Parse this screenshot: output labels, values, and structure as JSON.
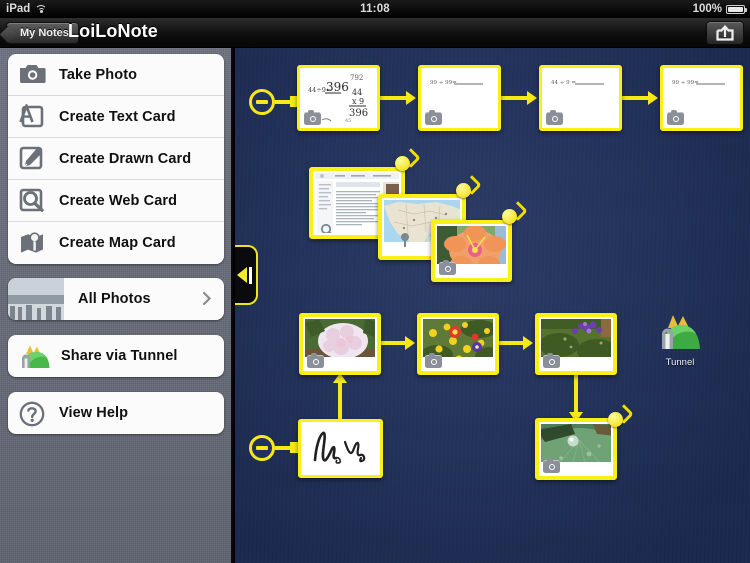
{
  "status_bar": {
    "device": "iPad",
    "wifi_icon": "wifi-icon",
    "time": "11:08",
    "battery_percent": "100%",
    "battery_icon": "battery-full-icon"
  },
  "navbar": {
    "back_button": "My Notes",
    "title": "LoiLoNote",
    "share_button_icon": "share-export-icon"
  },
  "sidebar": {
    "create_group": [
      {
        "label": "Take Photo",
        "icon": "camera-icon"
      },
      {
        "label": "Create Text Card",
        "icon": "text-card-icon"
      },
      {
        "label": "Create Drawn Card",
        "icon": "pencil-draw-icon"
      },
      {
        "label": "Create Web Card",
        "icon": "magnifier-web-icon"
      },
      {
        "label": "Create Map Card",
        "icon": "map-pin-icon"
      }
    ],
    "photos_row": {
      "label": "All Photos",
      "icon": "photo-thumbnail",
      "chevron": "chevron-right-icon"
    },
    "share_row": {
      "label": "Share via Tunnel",
      "icon": "tunnel-icon"
    },
    "help_row": {
      "label": "View Help",
      "icon": "question-mark-icon"
    }
  },
  "canvas": {
    "background_color": "#20325f",
    "accent_color": "#f7e817",
    "drawer_toggle": {
      "name": "collapse-sidebar-tab",
      "icon": "triangle-left-icon"
    },
    "tunnel_shortcut": {
      "label": "Tunnel",
      "icon": "tunnel-icon"
    },
    "rows": [
      {
        "name": "top-row-note-chain",
        "start_node": "minus-collapse-node",
        "cards": [
          {
            "type": "text-note",
            "content": "44÷9=396   792  44  x 9  396",
            "badge": "camera-badge"
          },
          {
            "type": "text-note",
            "content": "99 ÷ 99 = ______",
            "badge": "camera-badge"
          },
          {
            "type": "text-note",
            "content": "44 ÷ 9 = ______",
            "badge": "camera-badge"
          },
          {
            "type": "text-note",
            "content": "99 ÷ 99 = ______",
            "badge": "camera-badge"
          }
        ]
      },
      {
        "name": "media-stack",
        "cards": [
          {
            "type": "web-card",
            "content": "web page screenshot",
            "handle": "rotate-handle"
          },
          {
            "type": "map-card",
            "content": "north america map with pin",
            "handle": "rotate-handle"
          },
          {
            "type": "photo-card",
            "content": "orange hibiscus flower",
            "handle": "rotate-handle",
            "badge": "camera-badge"
          }
        ]
      },
      {
        "name": "bottom-photo-chain",
        "cards": [
          {
            "type": "photo-card",
            "content": "pink hydrangea blossom",
            "badge": "camera-badge"
          },
          {
            "type": "photo-card",
            "content": "yellow and red wildflowers",
            "badge": "camera-badge"
          },
          {
            "type": "photo-card",
            "content": "purple flowers in green foliage",
            "badge": "camera-badge"
          }
        ]
      },
      {
        "name": "drawn-card-branch",
        "start_node": "minus-collapse-node",
        "cards": [
          {
            "type": "drawn-card",
            "content": "handwritten scribble strokes"
          }
        ]
      },
      {
        "name": "leaf-photo-card",
        "cards": [
          {
            "type": "photo-card",
            "content": "water droplet on green leaf",
            "handle": "rotate-handle",
            "badge": "camera-badge"
          }
        ]
      }
    ]
  }
}
